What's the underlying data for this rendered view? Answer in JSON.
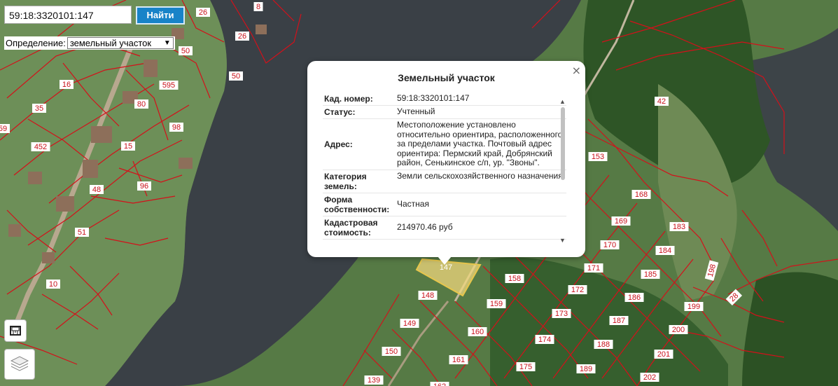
{
  "search": {
    "value": "59:18:3320101:147",
    "button_label": "Найти"
  },
  "definition": {
    "label": "Определение:",
    "selected": "земельный участок"
  },
  "controls": {
    "ruler_icon": "ruler-icon",
    "layers_icon": "layers-icon"
  },
  "popup": {
    "title": "Земельный участок",
    "close_label": "×",
    "rows": [
      {
        "key": "Кад. номер:",
        "value": "59:18:3320101:147"
      },
      {
        "key": "Статус:",
        "value": "Учтенный"
      },
      {
        "key": "Адрес:",
        "value": "Местоположение установлено относительно ориентира, расположенного за пределами участка. Почтовый адрес ориентира: Пермский край, Добрянский район, Сенькинское с/п, ур. \"Звоны\"."
      },
      {
        "key": "Категория земель:",
        "value": "Земли сельскохозяйственного назначения"
      },
      {
        "key": "Форма собственности:",
        "value": "Частная"
      },
      {
        "key": "Кадастровая стоимость:",
        "value": "214970.46 руб"
      }
    ]
  },
  "parcel_labels": [
    "26",
    "8",
    "26",
    "50",
    "595",
    "50",
    "16",
    "80",
    "35",
    "98",
    "59",
    "452",
    "15",
    "96",
    "48",
    "51",
    "10",
    "42",
    "153",
    "168",
    "169",
    "183",
    "170",
    "184",
    "171",
    "185",
    "147",
    "158",
    "148",
    "172",
    "186",
    "199",
    "159",
    "173",
    "187",
    "200",
    "149",
    "160",
    "174",
    "188",
    "201",
    "150",
    "161",
    "175",
    "189",
    "202",
    "139",
    "162",
    "198",
    "28"
  ],
  "colors": {
    "boundary": "#d4101a",
    "selected_fill": "#f3e08a",
    "water": "#3b4148",
    "accent": "#1883c8"
  }
}
